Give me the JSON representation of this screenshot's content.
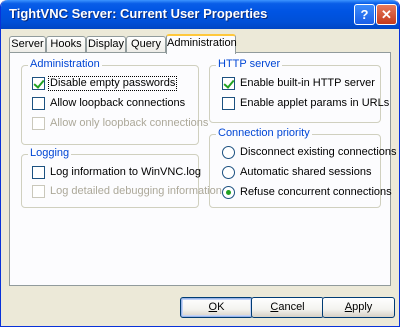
{
  "window": {
    "title": "TightVNC Server: Current User Properties",
    "help_label": "?",
    "close_label": "✕"
  },
  "tabs": [
    {
      "label": "Server"
    },
    {
      "label": "Hooks"
    },
    {
      "label": "Display"
    },
    {
      "label": "Query"
    },
    {
      "label": "Administration",
      "active": true
    }
  ],
  "administration": {
    "legend": "Administration",
    "items": [
      {
        "label": "Disable empty passwords",
        "checked": true,
        "enabled": true
      },
      {
        "label": "Allow loopback connections",
        "checked": false,
        "enabled": true
      },
      {
        "label": "Allow only loopback connections",
        "checked": false,
        "enabled": false
      }
    ]
  },
  "logging": {
    "legend": "Logging",
    "items": [
      {
        "label": "Log information to WinVNC.log",
        "checked": false,
        "enabled": true
      },
      {
        "label": "Log detailed debugging information",
        "checked": false,
        "enabled": false
      }
    ]
  },
  "http_server": {
    "legend": "HTTP server",
    "items": [
      {
        "label": "Enable built-in HTTP server",
        "checked": true,
        "enabled": true
      },
      {
        "label": "Enable applet params in URLs",
        "checked": false,
        "enabled": true
      }
    ]
  },
  "connection_priority": {
    "legend": "Connection priority",
    "options": [
      {
        "label": "Disconnect existing connections",
        "selected": false
      },
      {
        "label": "Automatic shared sessions",
        "selected": false
      },
      {
        "label": "Refuse concurrent connections",
        "selected": true
      }
    ]
  },
  "buttons": {
    "ok": {
      "label": "OK",
      "mnemonic": "O",
      "rest": "K"
    },
    "cancel": {
      "label": "Cancel",
      "mnemonic": "C",
      "rest": "ancel"
    },
    "apply": {
      "label": "Apply",
      "mnemonic": "A",
      "rest": "pply"
    }
  }
}
